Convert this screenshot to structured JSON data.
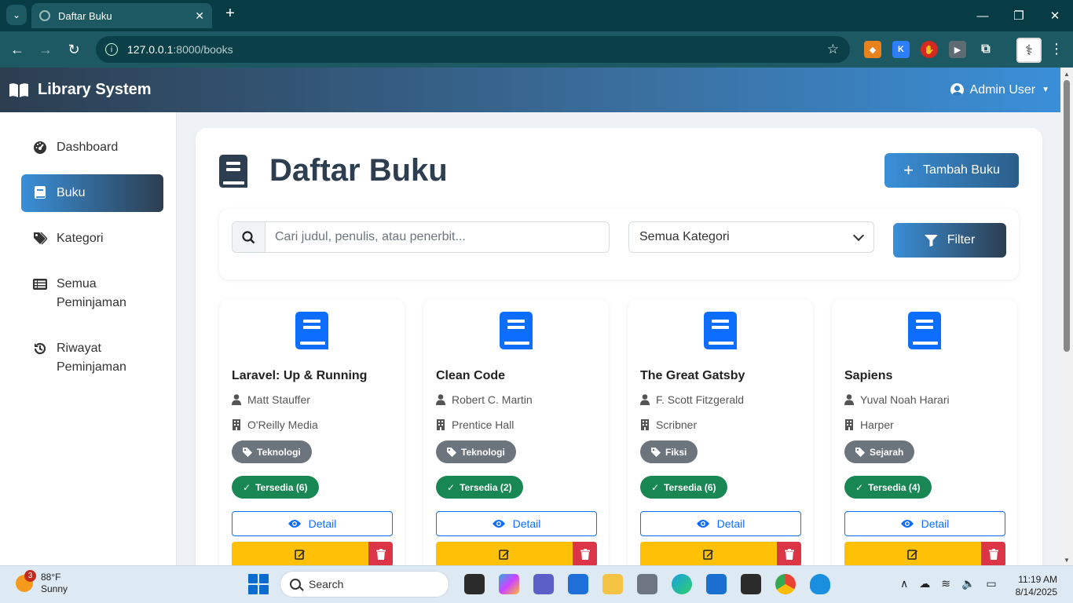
{
  "browser": {
    "tab_title": "Daftar Buku",
    "url_host": "127.0.0.1",
    "url_path": ":8000/books"
  },
  "header": {
    "brand": "Library System",
    "user": "Admin User"
  },
  "sidebar": {
    "items": [
      {
        "label": "Dashboard",
        "icon": "dashboard-icon",
        "active": false
      },
      {
        "label": "Buku",
        "icon": "book-icon",
        "active": true
      },
      {
        "label": "Kategori",
        "icon": "tags-icon",
        "active": false
      },
      {
        "label": "Semua Peminjaman",
        "icon": "list-icon",
        "active": false
      },
      {
        "label": "Riwayat Peminjaman",
        "icon": "history-icon",
        "active": false
      }
    ]
  },
  "page": {
    "title": "Daftar Buku",
    "add_button": "Tambah Buku",
    "search_placeholder": "Cari judul, penulis, atau penerbit...",
    "category_selected": "Semua Kategori",
    "filter_button": "Filter"
  },
  "books": [
    {
      "title": "Laravel: Up & Running",
      "author": "Matt Stauffer",
      "publisher": "O'Reilly Media",
      "category": "Teknologi",
      "stock": "Tersedia (6)",
      "detail": "Detail"
    },
    {
      "title": "Clean Code",
      "author": "Robert C. Martin",
      "publisher": "Prentice Hall",
      "category": "Teknologi",
      "stock": "Tersedia (2)",
      "detail": "Detail"
    },
    {
      "title": "The Great Gatsby",
      "author": "F. Scott Fitzgerald",
      "publisher": "Scribner",
      "category": "Fiksi",
      "stock": "Tersedia (6)",
      "detail": "Detail"
    },
    {
      "title": "Sapiens",
      "author": "Yuval Noah Harari",
      "publisher": "Harper",
      "category": "Sejarah",
      "stock": "Tersedia (4)",
      "detail": "Detail"
    }
  ],
  "taskbar": {
    "weather_temp": "88°F",
    "weather_cond": "Sunny",
    "weather_badge": "3",
    "search": "Search",
    "time": "11:19 AM",
    "date": "8/14/2025"
  },
  "colors": {
    "brand_dark": "#2c3e50",
    "brand_blue": "#3a8fd8",
    "success": "#198754",
    "warning": "#ffc107",
    "danger": "#dc3545",
    "primary": "#0d6efd"
  }
}
